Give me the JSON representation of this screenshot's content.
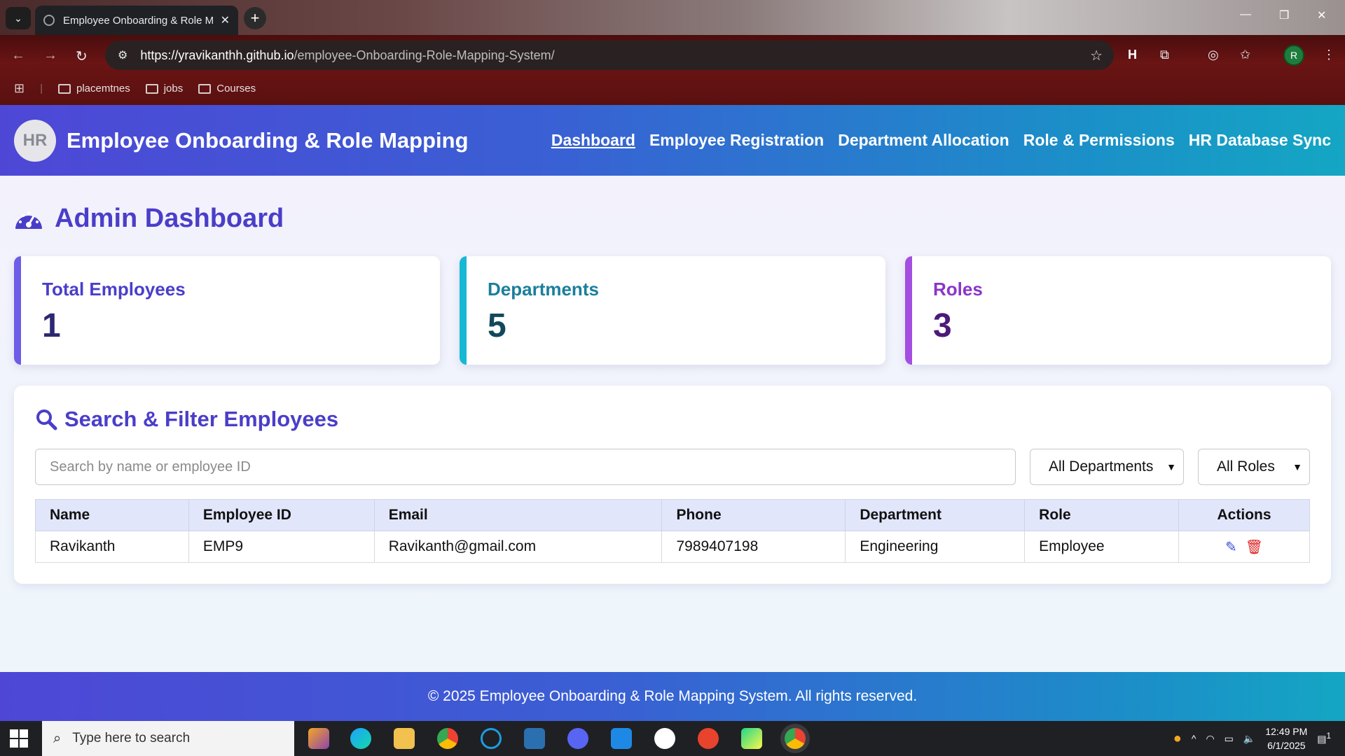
{
  "browser": {
    "tab_title": "Employee Onboarding & Role M",
    "url_host": "https://yravikanthh.github.io",
    "url_path": "/employee-Onboarding-Role-Mapping-System/",
    "bookmarks": [
      "placemtnes",
      "jobs",
      "Courses"
    ],
    "profile_initial": "R"
  },
  "app": {
    "logo_text": "HR",
    "title": "Employee Onboarding & Role Mapping",
    "nav": [
      "Dashboard",
      "Employee Registration",
      "Department Allocation",
      "Role & Permissions",
      "HR Database Sync"
    ],
    "active_nav": "Dashboard"
  },
  "dashboard": {
    "title": "Admin Dashboard",
    "stats": [
      {
        "label": "Total Employees",
        "value": "1",
        "accent": "#6c5ce7",
        "label_color": "#4a3ec9",
        "value_color": "#2c2870"
      },
      {
        "label": "Departments",
        "value": "5",
        "accent": "#16b8d4",
        "label_color": "#1a7f9c",
        "value_color": "#12485c"
      },
      {
        "label": "Roles",
        "value": "3",
        "accent": "#a34ee0",
        "label_color": "#8a36c8",
        "value_color": "#4b1a7a"
      }
    ]
  },
  "filter": {
    "title": "Search & Filter Employees",
    "search_placeholder": "Search by name or employee ID",
    "department_select": "All Departments",
    "role_select": "All Roles"
  },
  "table": {
    "columns": [
      "Name",
      "Employee ID",
      "Email",
      "Phone",
      "Department",
      "Role",
      "Actions"
    ],
    "rows": [
      {
        "name": "Ravikanth",
        "id": "EMP9",
        "email": "Ravikanth@gmail.com",
        "phone": "7989407198",
        "department": "Engineering",
        "role": "Employee"
      }
    ]
  },
  "footer": {
    "text": "© 2025 Employee Onboarding & Role Mapping System. All rights reserved."
  },
  "taskbar": {
    "search_placeholder": "Type here to search",
    "time": "12:49 PM",
    "date": "6/1/2025",
    "notification_count": "1"
  }
}
